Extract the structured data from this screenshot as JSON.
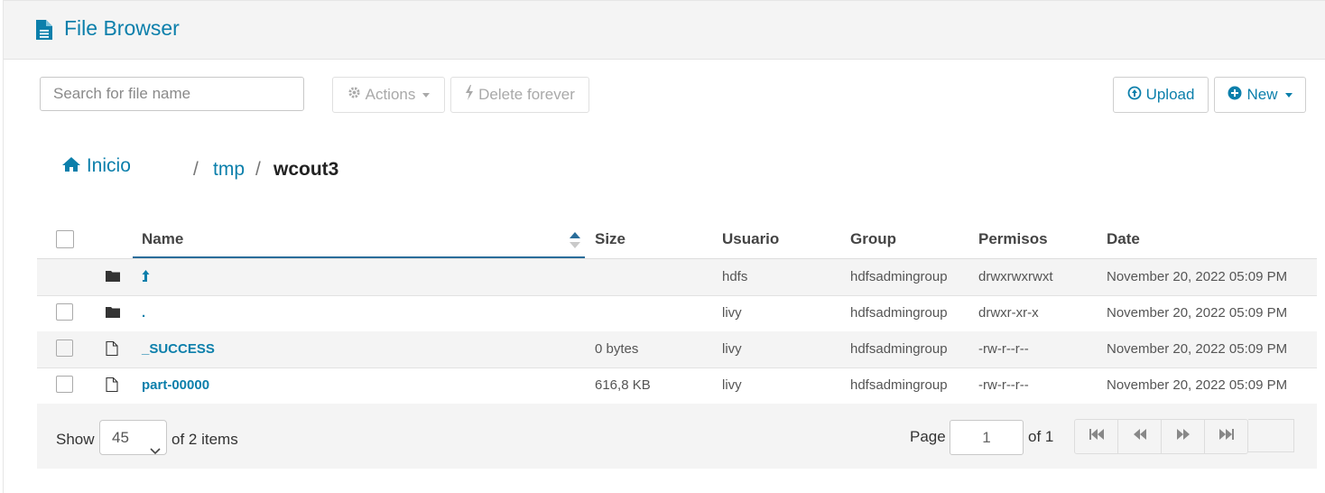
{
  "header": {
    "title": "File Browser",
    "icon": "document-icon"
  },
  "toolbar": {
    "search_placeholder": "Search for file name",
    "actions_label": "Actions",
    "delete_label": "Delete forever",
    "upload_label": "Upload",
    "new_label": "New"
  },
  "breadcrumb": {
    "home": "Inicio",
    "sep1": "/",
    "tmp": "tmp",
    "sep2": "/",
    "current": "wcout3"
  },
  "table": {
    "columns": [
      "Name",
      "Size",
      "Usuario",
      "Group",
      "Permisos",
      "Date"
    ],
    "rows": [
      {
        "name": "",
        "type": "parent-folder",
        "size": "",
        "user": "hdfs",
        "group": "hdfsadmingroup",
        "perms": "drwxrwxrwxt",
        "date": "November 20, 2022 05:09 PM"
      },
      {
        "name": ".",
        "type": "folder",
        "size": "",
        "user": "livy",
        "group": "hdfsadmingroup",
        "perms": "drwxr-xr-x",
        "date": "November 20, 2022 05:09 PM"
      },
      {
        "name": "_SUCCESS",
        "type": "file",
        "size": "0 bytes",
        "user": "livy",
        "group": "hdfsadmingroup",
        "perms": "-rw-r--r--",
        "date": "November 20, 2022 05:09 PM"
      },
      {
        "name": "part-00000",
        "type": "file",
        "size": "616,8 KB",
        "user": "livy",
        "group": "hdfsadmingroup",
        "perms": "-rw-r--r--",
        "date": "November 20, 2022 05:09 PM"
      }
    ]
  },
  "footer": {
    "show_label": "Show",
    "page_size": "45",
    "items_label": "of 2 items",
    "page_label": "Page",
    "page_value": "1",
    "of_pages": "of 1"
  },
  "colors": {
    "accent": "#0b7fab",
    "header_bg": "#f4f4f4",
    "alt_row": "#f4f4f4"
  }
}
